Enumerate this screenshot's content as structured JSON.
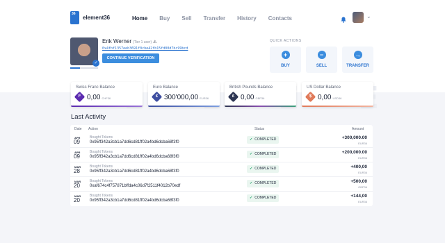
{
  "app": {
    "logo_badge": "36",
    "logo_text": "element36"
  },
  "nav": [
    "Home",
    "Buy",
    "Sell",
    "Transfer",
    "History",
    "Contacts"
  ],
  "user": {
    "name": "Erik Werner",
    "tier": "(Tier 1 user)",
    "address": "0x4fbf1357eeb3691f0cbe42fb15fd00d7bc99bcd",
    "verify_label": "CONTINUE VERIFICATION"
  },
  "quick_actions": {
    "title": "QUICK ACTIONS",
    "items": [
      {
        "label": "BUY",
        "icon": "+"
      },
      {
        "label": "SELL",
        "icon": "−"
      },
      {
        "label": "TRANSFER",
        "icon": "→"
      }
    ]
  },
  "balances": [
    {
      "title": "Swiss Franc Balance",
      "amount": "0,00",
      "currency": "CHF36",
      "symbol": "F",
      "color": "#5b2bb0"
    },
    {
      "title": "Euro Balance",
      "amount": "300'000,00",
      "currency": "EUR36",
      "symbol": "€",
      "color": "#3e4ea0"
    },
    {
      "title": "British Pounds Balance",
      "amount": "0,00",
      "currency": "GBP36",
      "symbol": "£",
      "color": "#2d3653"
    },
    {
      "title": "US Dollar Balance",
      "amount": "0,00",
      "currency": "USD36",
      "symbol": "$",
      "color": "#e07a5a"
    }
  ],
  "activity": {
    "title": "Last Activity",
    "headers": {
      "date": "Date",
      "action": "Action",
      "status": "Status",
      "amount": "Amount"
    },
    "rows": [
      {
        "month": "APR",
        "day": "09",
        "action": "Bought Tokens",
        "hash": "0x95ff342a3cb1a7dd6cd81ff02a4bd6dcba68f3f0",
        "status": "COMPLETED",
        "amount": "+300,000.00",
        "currency": "EUR36"
      },
      {
        "month": "APR",
        "day": "09",
        "action": "Bought Tokens",
        "hash": "0x95ff342a3cb1a7dd6cd81ff02a4bd6dcba68f3f0",
        "status": "COMPLETED",
        "amount": "+200,000.00",
        "currency": "EUR36"
      },
      {
        "month": "MAR",
        "day": "28",
        "action": "Bought Tokens",
        "hash": "0x95ff342a3cb1a7dd6cd81ff02a4bd6dcba68f3f0",
        "status": "COMPLETED",
        "amount": "+400,00",
        "currency": "EUR36"
      },
      {
        "month": "MAR",
        "day": "20",
        "action": "Bought Tokens",
        "hash": "0xaf674c4f757871bffda4c06d7f2511f4012b70edf",
        "status": "COMPLETED",
        "amount": "+500,00",
        "currency": "GBP36"
      },
      {
        "month": "MAR",
        "day": "20",
        "action": "Bought Tokens",
        "hash": "0x95ff342a3cb1a7dd6cd81ff02a4bd6dcba68f3f0",
        "status": "COMPLETED",
        "amount": "+144,00",
        "currency": "EUR36"
      }
    ]
  }
}
